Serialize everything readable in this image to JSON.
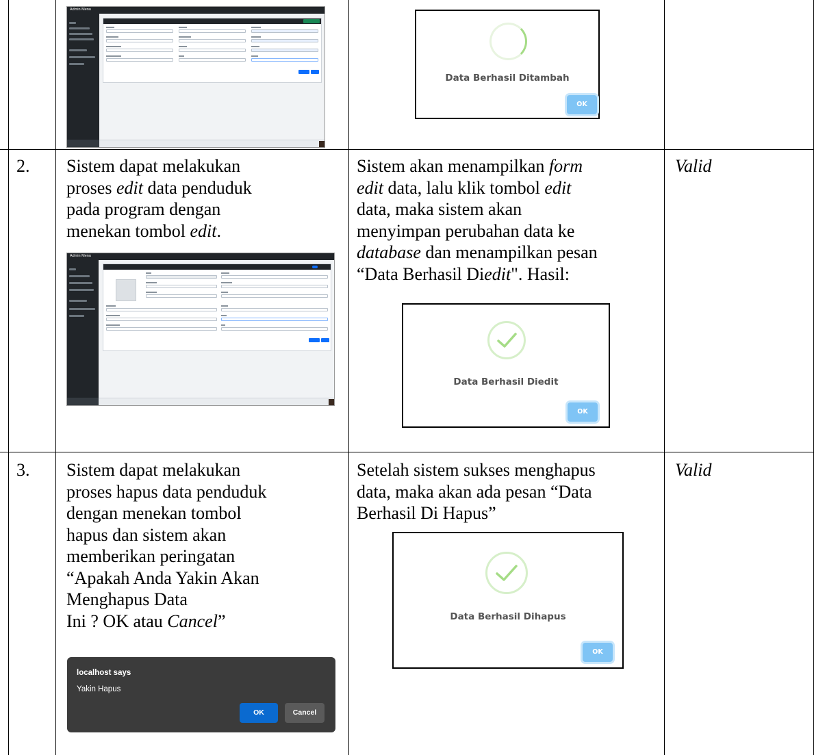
{
  "row1": {
    "screenshot": {
      "app_title": "Admin Menu",
      "card_title": "Tambah Penduduk"
    },
    "modal": {
      "message": "Data Berhasil Ditambah",
      "ok_label": "OK",
      "icon": "loading-spinner-icon"
    }
  },
  "row2": {
    "number": "2.",
    "scenario": {
      "line1": "Sistem dapat melakukan",
      "line2a": "proses ",
      "line2b": "edit",
      "line2c": " data penduduk",
      "line3": "pada program dengan",
      "line4a": "menekan tombol ",
      "line4b": "edit",
      "line4c": "."
    },
    "expected": {
      "line1a": "Sistem akan menampilkan ",
      "line1b": "form",
      "line2a": "edit",
      "line2b": " data, lalu klik tombol ",
      "line2c": "edit",
      "line3": "data, maka sistem akan",
      "line4": "menyimpan perubahan data ke",
      "line5a": "database",
      "line5b": " dan menampilkan pesan",
      "line6a": "“Data Berhasil Di",
      "line6b": "edit",
      "line6c": "\". Hasil:"
    },
    "result": "Valid",
    "screenshot": {
      "app_title": "Admin Menu",
      "card_title": "ID Penduduk : 31"
    },
    "modal": {
      "message": "Data Berhasil Diedit",
      "ok_label": "OK",
      "icon": "checkmark-icon"
    }
  },
  "row3": {
    "number": "3.",
    "scenario": {
      "line1": "Sistem dapat melakukan",
      "line2": "proses hapus data penduduk",
      "line3": "dengan menekan tombol",
      "line4": "hapus dan sistem akan",
      "line5": "memberikan peringatan",
      "line6": "“Apakah Anda Yakin Akan",
      "line7": "Menghapus Data",
      "line8a": "Ini ? OK atau ",
      "line8b": "Cancel",
      "line8c": "”"
    },
    "expected": {
      "line1": "Setelah sistem sukses menghapus",
      "line2": "data, maka akan ada pesan “Data",
      "line3": "Berhasil Di Hapus”"
    },
    "result": "Valid",
    "confirm_dialog": {
      "title": "localhost says",
      "message": "Yakin Hapus",
      "ok_label": "OK",
      "cancel_label": "Cancel"
    },
    "modal": {
      "message": "Data Berhasil Dihapus",
      "ok_label": "OK",
      "icon": "checkmark-icon"
    }
  },
  "colors": {
    "modal_button": "#7fc4f5",
    "check_green": "#a5dc86",
    "dialog_bg": "#3b3b3b",
    "dialog_ok": "#0a6ad0"
  }
}
